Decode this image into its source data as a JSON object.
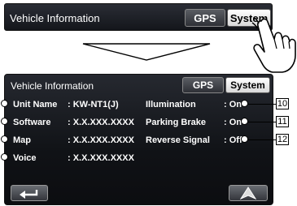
{
  "top_screen": {
    "title": "Vehicle Information",
    "tabs": [
      {
        "label": "GPS",
        "active": false
      },
      {
        "label": "System",
        "active": true
      }
    ]
  },
  "main_screen": {
    "title": "Vehicle Information",
    "tabs": [
      {
        "label": "GPS",
        "active": false
      },
      {
        "label": "System",
        "active": true
      }
    ],
    "left_items": [
      {
        "label": "Unit Name",
        "value": ": KW-NT1(J)"
      },
      {
        "label": "Software",
        "value": ": X.X.XXX.XXXX"
      },
      {
        "label": "Map",
        "value": ": X.X.XXX.XXXX"
      },
      {
        "label": "Voice",
        "value": ": X.X.XXX.XXXX"
      }
    ],
    "right_items": [
      {
        "label": "Illumination",
        "value": ": On"
      },
      {
        "label": "Parking Brake",
        "value": ": On"
      },
      {
        "label": "Reverse Signal",
        "value": ": Off"
      }
    ],
    "callouts": [
      "10",
      "11",
      "12"
    ]
  },
  "icons": {
    "back": "back-arrow-icon",
    "navigation": "navigation-triangle-icon",
    "hand": "hand-pointer-icon",
    "arrow": "down-arrow-icon"
  }
}
